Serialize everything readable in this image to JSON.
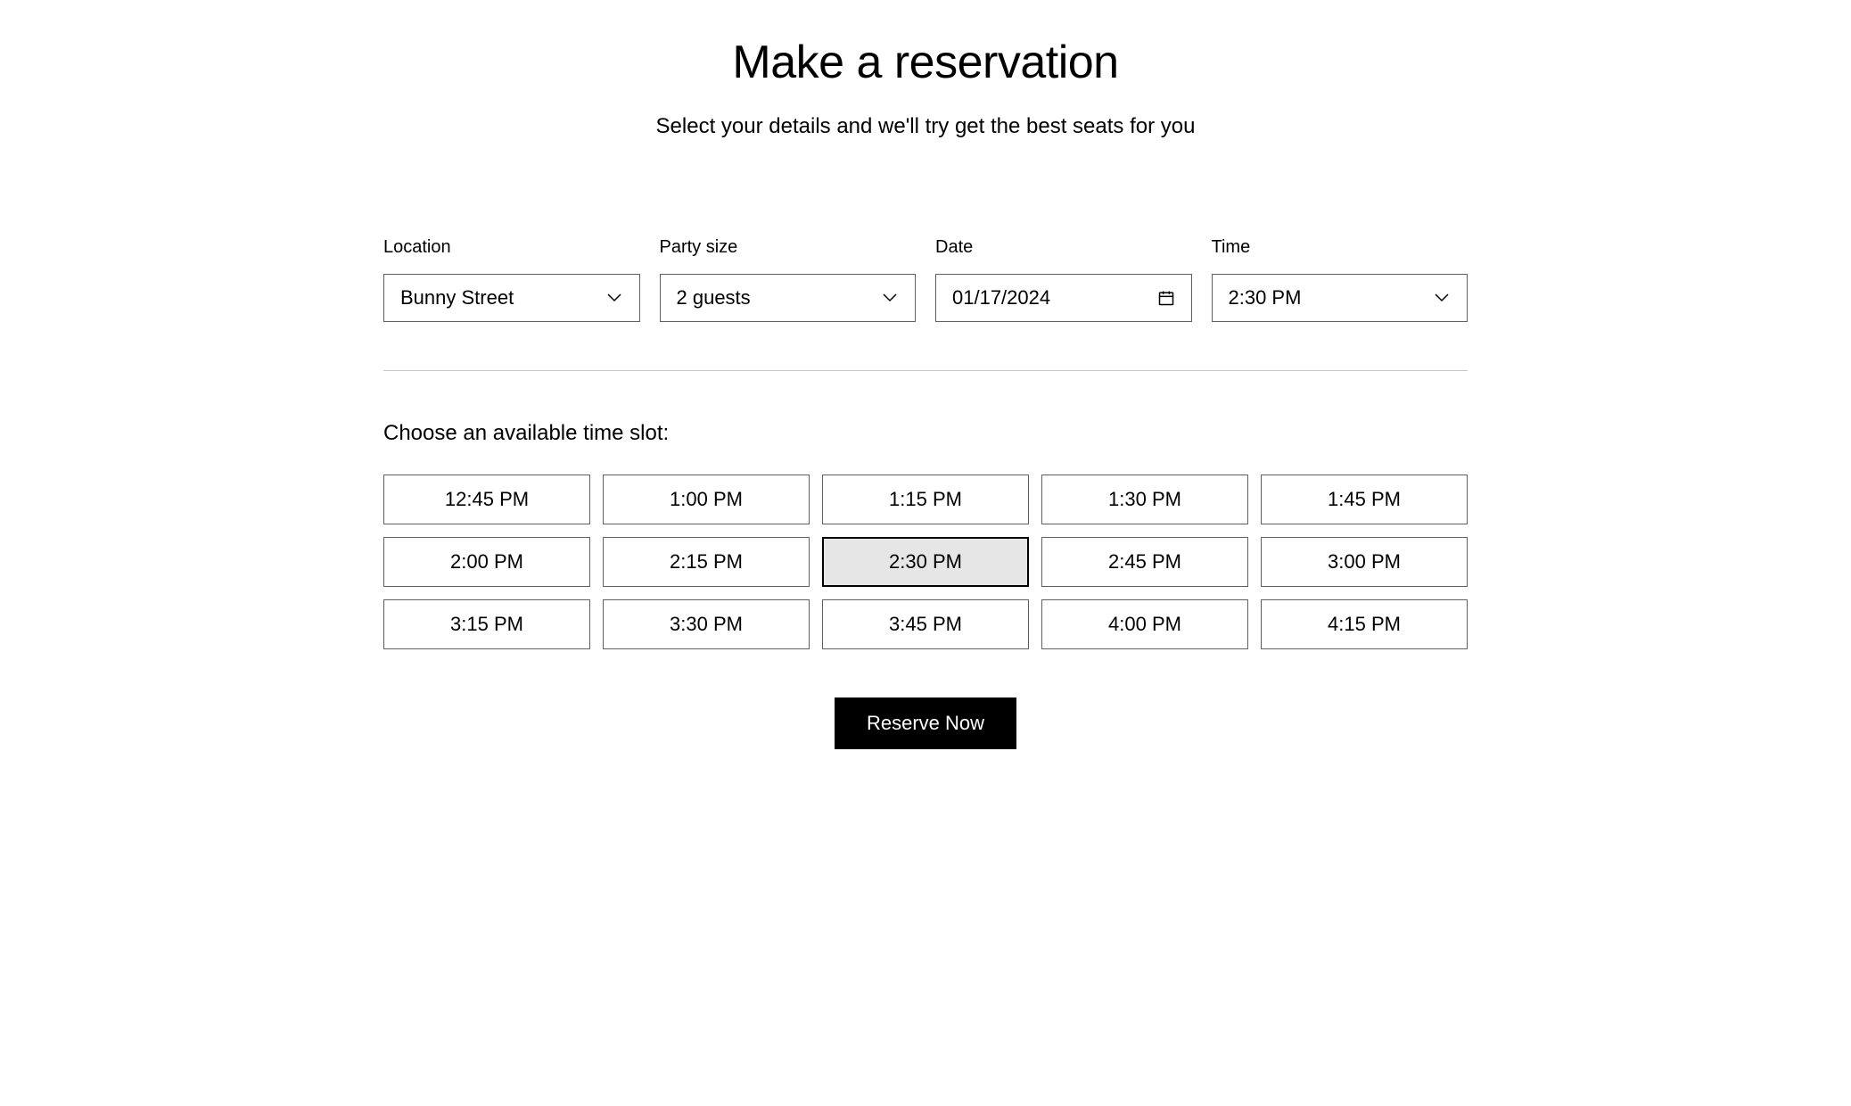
{
  "header": {
    "title": "Make a reservation",
    "subtitle": "Select your details and we'll try get the best seats for you"
  },
  "form": {
    "location": {
      "label": "Location",
      "value": "Bunny Street"
    },
    "party_size": {
      "label": "Party size",
      "value": "2 guests"
    },
    "date": {
      "label": "Date",
      "value": "01/17/2024"
    },
    "time": {
      "label": "Time",
      "value": "2:30 PM"
    }
  },
  "timeslots": {
    "label": "Choose an available time slot:",
    "selected_index": 7,
    "options": [
      "12:45 PM",
      "1:00 PM",
      "1:15 PM",
      "1:30 PM",
      "1:45 PM",
      "2:00 PM",
      "2:15 PM",
      "2:30 PM",
      "2:45 PM",
      "3:00 PM",
      "3:15 PM",
      "3:30 PM",
      "3:45 PM",
      "4:00 PM",
      "4:15 PM"
    ]
  },
  "actions": {
    "reserve_label": "Reserve Now"
  }
}
